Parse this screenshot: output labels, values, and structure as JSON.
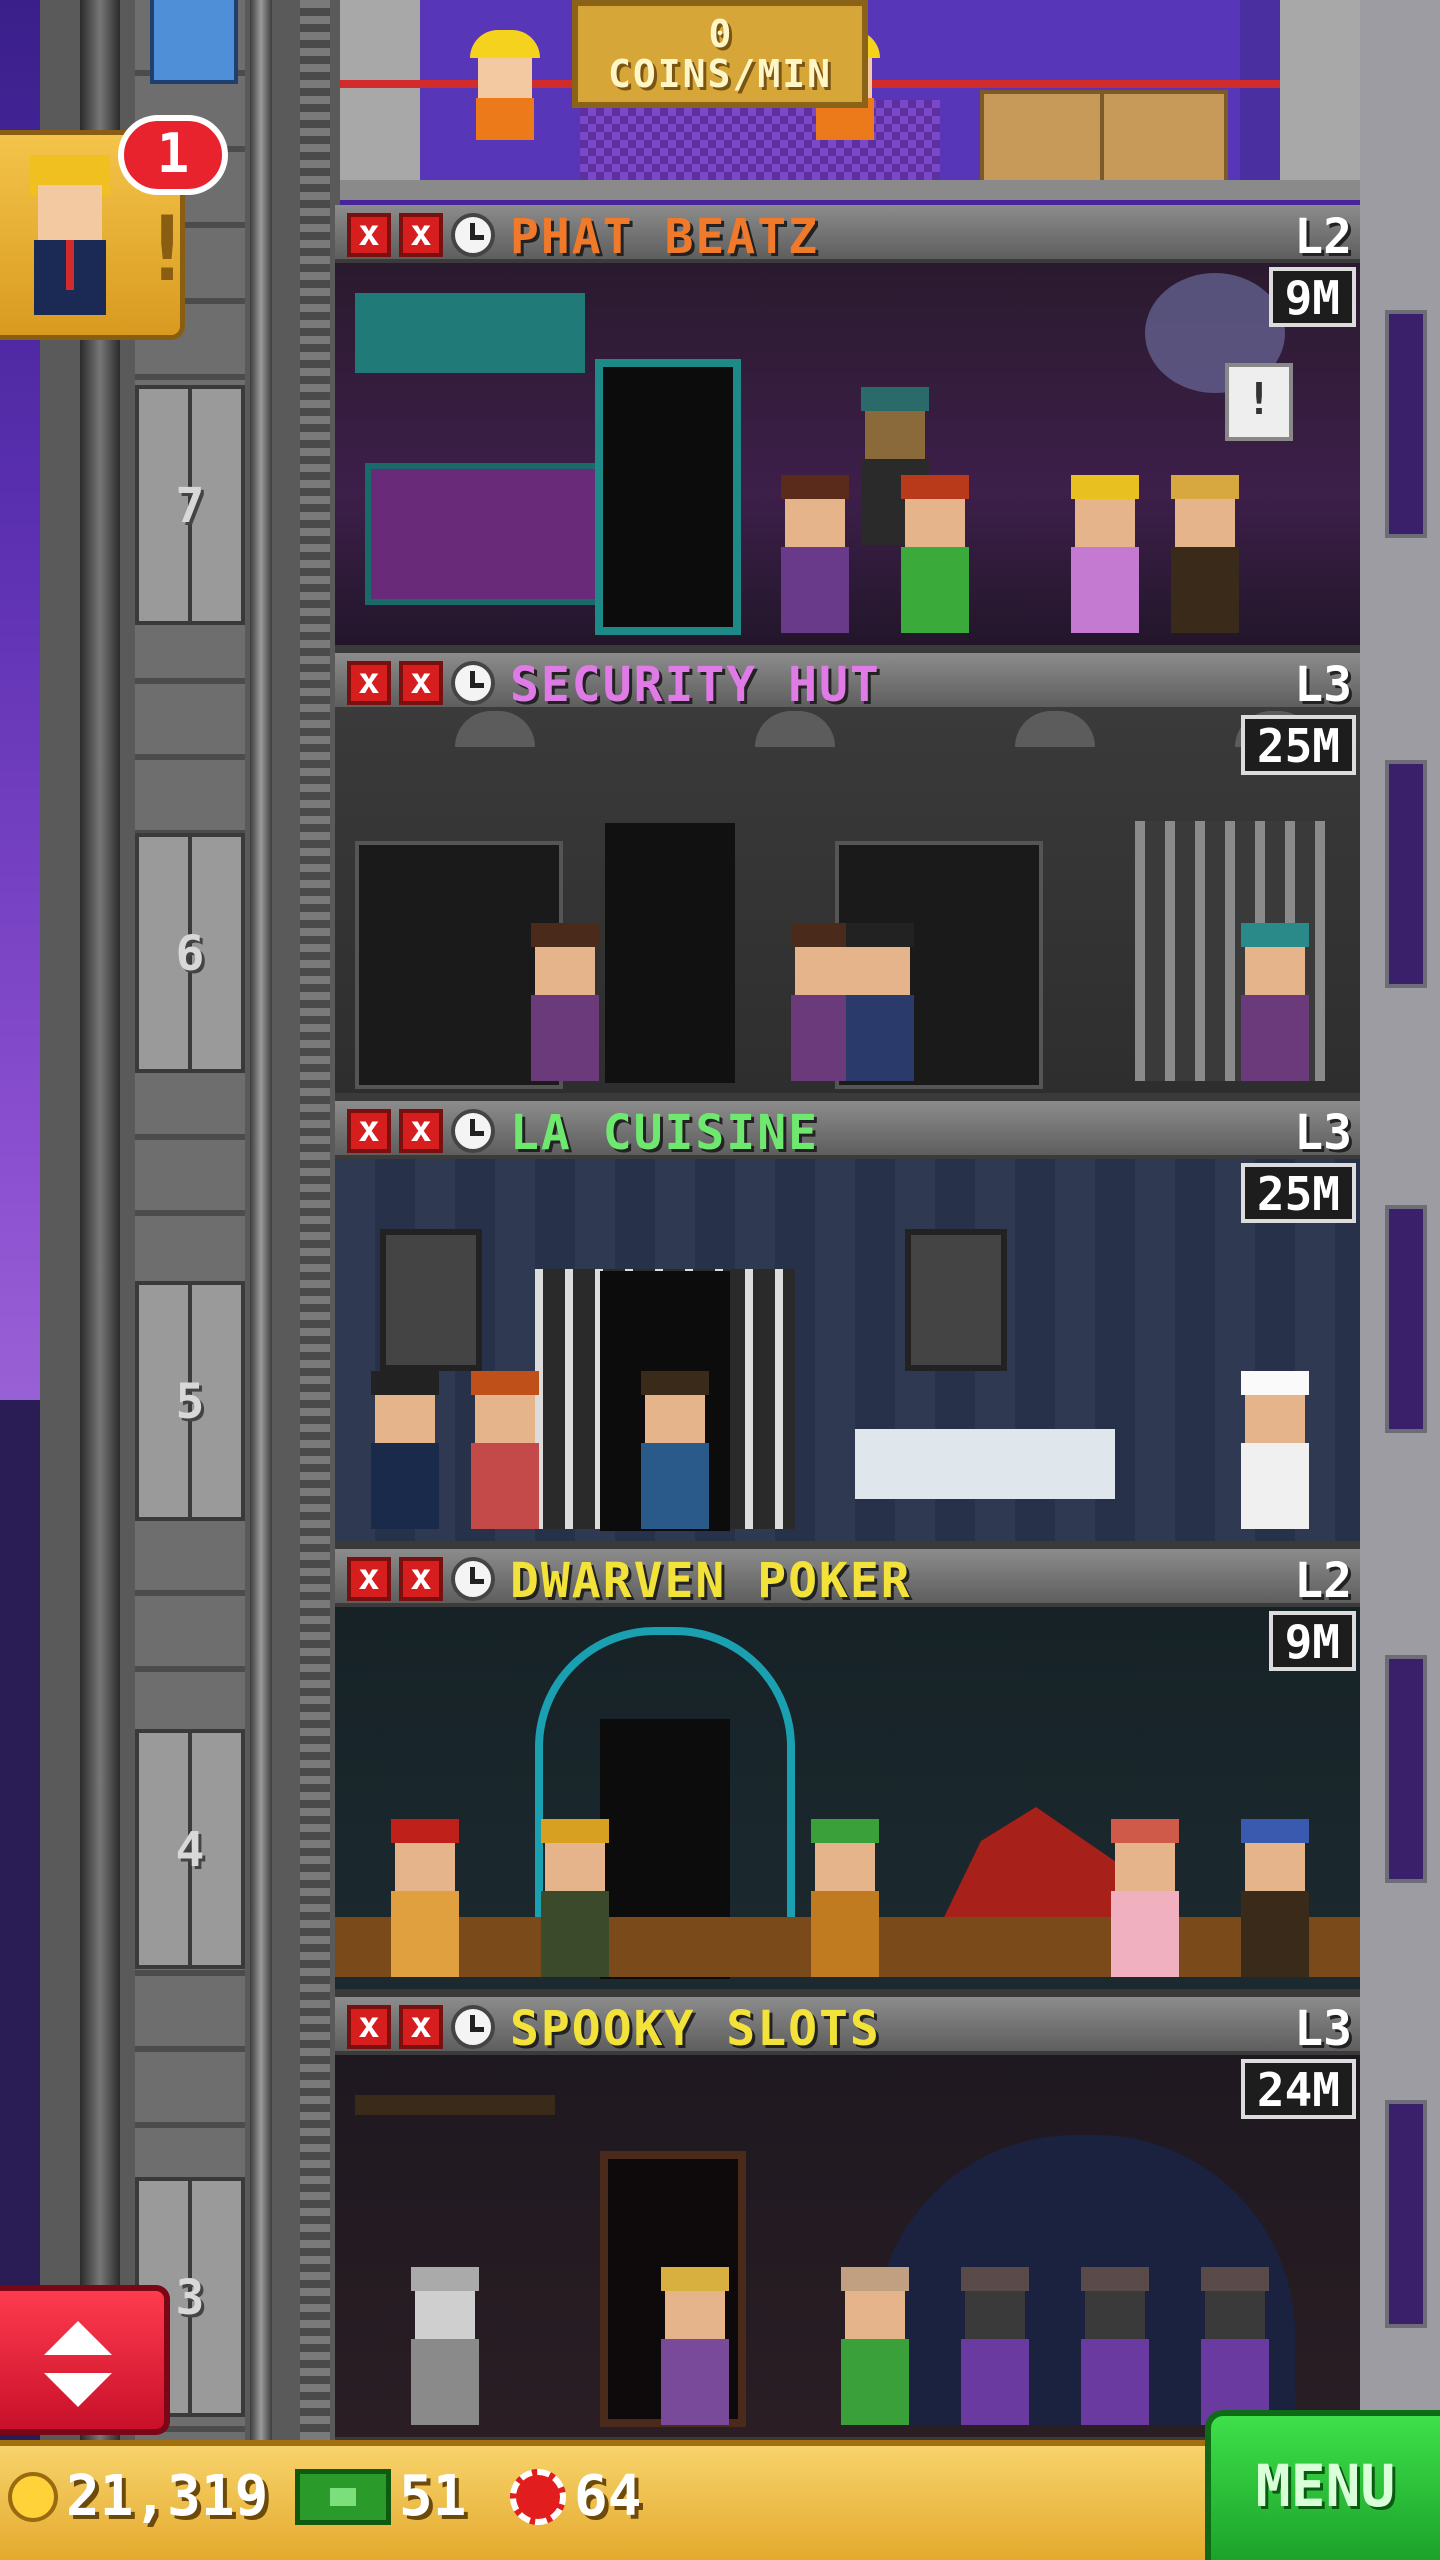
{
  "roof": {
    "coins_value": "0",
    "coins_unit": "COINS/MIN"
  },
  "notification": {
    "count": "1"
  },
  "elevator": {
    "floor_numbers": [
      "7",
      "6",
      "5",
      "4",
      "3"
    ]
  },
  "floors": [
    {
      "name": "PHAT BEATZ",
      "name_color": "#f07a2a",
      "level": "L2",
      "time": "9M"
    },
    {
      "name": "SECURITY HUT",
      "name_color": "#e07ae6",
      "level": "L3",
      "time": "25M"
    },
    {
      "name": "LA CUISINE",
      "name_color": "#6ee86e",
      "level": "L3",
      "time": "25M"
    },
    {
      "name": "DWARVEN POKER",
      "name_color": "#f2e23a",
      "level": "L2",
      "time": "9M"
    },
    {
      "name": "SPOOKY SLOTS",
      "name_color": "#f2e23a",
      "level": "L3",
      "time": "24M"
    }
  ],
  "status_bar": {
    "coins": "21,319",
    "bux": "51",
    "chips": "64"
  },
  "menu": {
    "label": "MENU"
  },
  "colors": {
    "accent_green": "#1ca22a",
    "accent_red": "#e8232d",
    "bar_gold": "#e4aa2e"
  },
  "icons": [
    "coin-icon",
    "bux-icon",
    "chip-icon",
    "close-icon",
    "clock-icon",
    "elevator-arrows-icon"
  ]
}
